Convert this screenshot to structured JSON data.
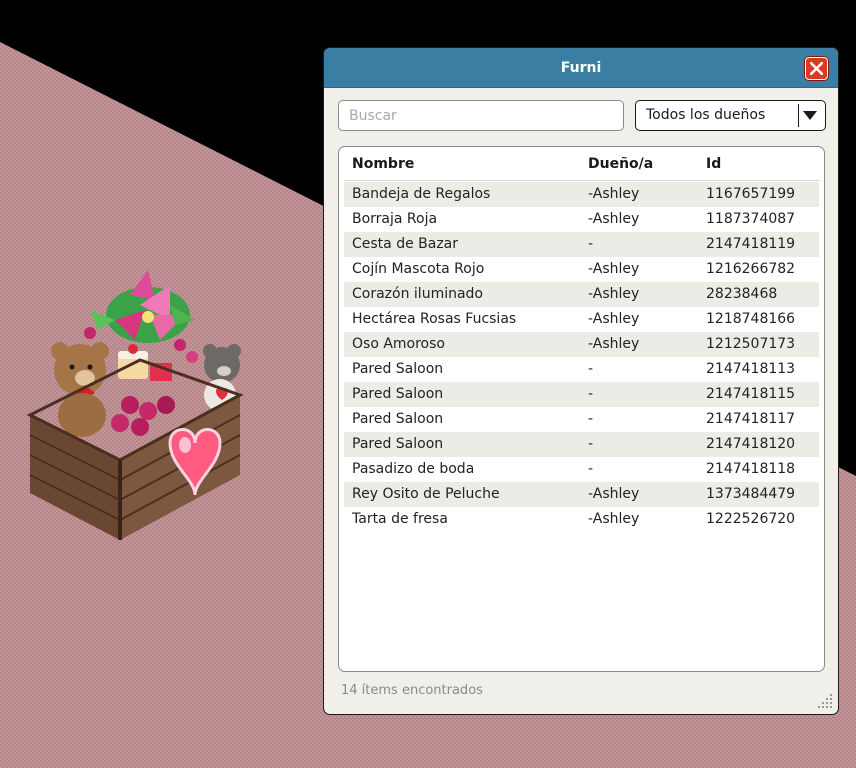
{
  "window": {
    "title": "Furni",
    "close_icon": "close-x-icon"
  },
  "search": {
    "placeholder": "Buscar",
    "value": ""
  },
  "owner_filter": {
    "selected": "Todos los dueños"
  },
  "table": {
    "columns": [
      "Nombre",
      "Dueño/a",
      "Id"
    ],
    "rows": [
      {
        "name": "Bandeja de Regalos",
        "owner": "-Ashley",
        "id": "1167657199"
      },
      {
        "name": "Borraja Roja",
        "owner": "-Ashley",
        "id": "1187374087"
      },
      {
        "name": "Cesta de Bazar",
        "owner": "-",
        "id": "2147418119"
      },
      {
        "name": "Cojín Mascota Rojo",
        "owner": "-Ashley",
        "id": "1216266782"
      },
      {
        "name": "Corazón iluminado",
        "owner": "-Ashley",
        "id": "28238468"
      },
      {
        "name": "Hectárea Rosas Fucsias",
        "owner": "-Ashley",
        "id": "1218748166"
      },
      {
        "name": "Oso Amoroso",
        "owner": "-Ashley",
        "id": "1212507173"
      },
      {
        "name": "Pared Saloon",
        "owner": "-",
        "id": "2147418113"
      },
      {
        "name": "Pared Saloon",
        "owner": "-",
        "id": "2147418115"
      },
      {
        "name": "Pared Saloon",
        "owner": "-",
        "id": "2147418117"
      },
      {
        "name": "Pared Saloon",
        "owner": "-",
        "id": "2147418120"
      },
      {
        "name": "Pasadizo de boda",
        "owner": "-",
        "id": "2147418118"
      },
      {
        "name": "Rey Osito de Peluche",
        "owner": "-Ashley",
        "id": "1373484479"
      },
      {
        "name": "Tarta de fresa",
        "owner": "-Ashley",
        "id": "1222526720"
      }
    ]
  },
  "status": {
    "count_text": "14 ítems encontrados"
  },
  "colors": {
    "titlebar": "#3a7ea3",
    "close_button": "#d93a26",
    "floor": "#c39598",
    "background": "#000000"
  }
}
